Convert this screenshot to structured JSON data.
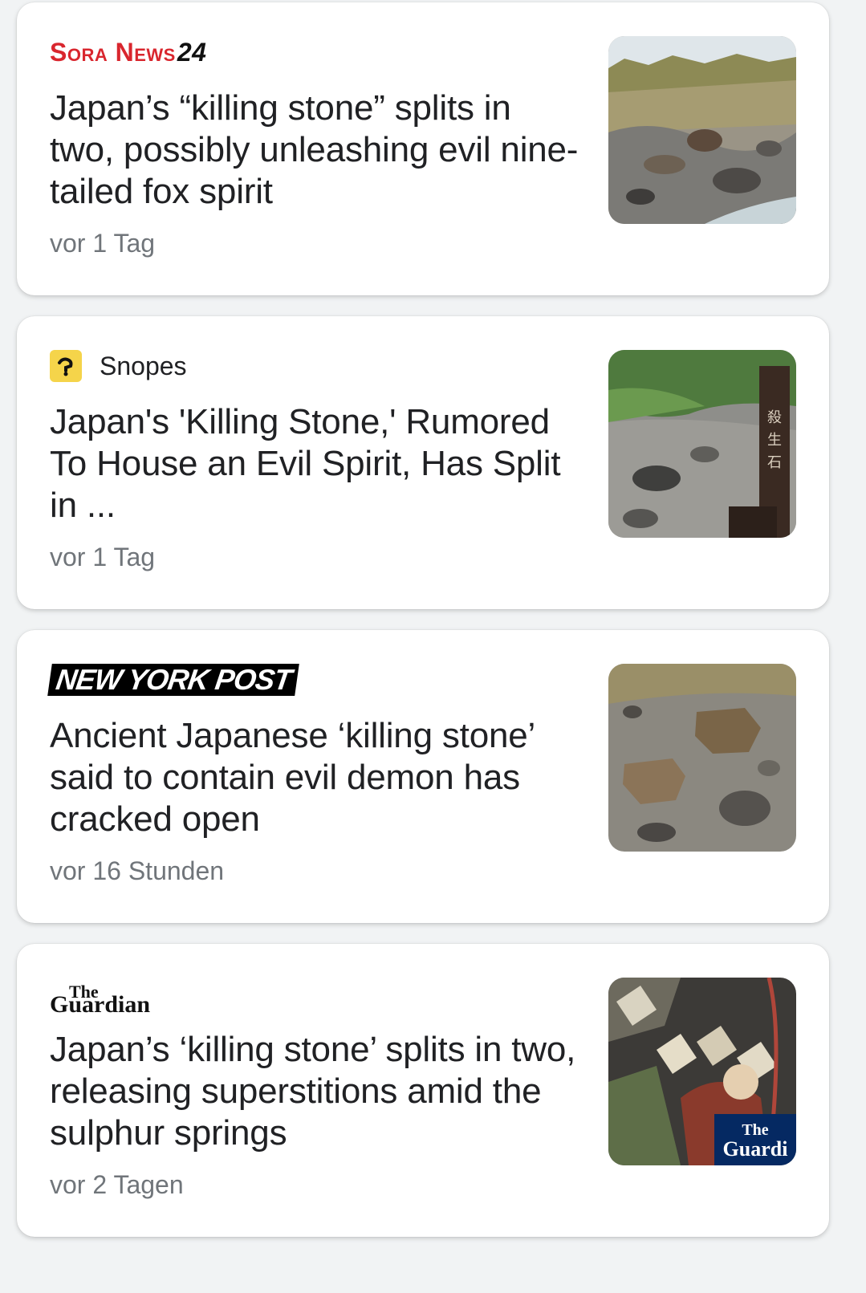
{
  "articles": [
    {
      "source": "Sora News 24",
      "source_logo_main": "Sora News",
      "source_logo_num": "24",
      "headline": "Japan’s “killing stone” splits in two, possibly unleashing evil nine-tailed fox spirit",
      "time": "vor 1 Tag",
      "thumbnail_icon": "rocky-hillside-image"
    },
    {
      "source": "Snopes",
      "headline": "Japan's 'Killing Stone,' Rumored To House an Evil Spirit, Has Split in ...",
      "time": "vor 1 Tag",
      "thumbnail_icon": "stone-with-signpost-image"
    },
    {
      "source": "NEW YORK POST",
      "headline": "Ancient Japanese ‘killing stone’ said to contain evil demon has cracked open",
      "time": "vor 16 Stunden",
      "thumbnail_icon": "split-stone-image"
    },
    {
      "source_logo_the": "The",
      "source_logo_name": "Guardian",
      "headline": "Japan’s ‘killing stone’ splits in two, releasing superstitions amid the sulphur springs",
      "time": "vor 2 Tagen",
      "thumbnail_icon": "woodblock-print-image",
      "thumbnail_badge_the": "The",
      "thumbnail_badge_name": "Guardi"
    }
  ],
  "colors": {
    "background": "#f1f3f4",
    "card": "#ffffff",
    "headline": "#202124",
    "timestamp": "#70757a",
    "sora_red": "#d9262e",
    "snopes_yellow": "#f5d44a",
    "guardian_blue": "#052962"
  }
}
